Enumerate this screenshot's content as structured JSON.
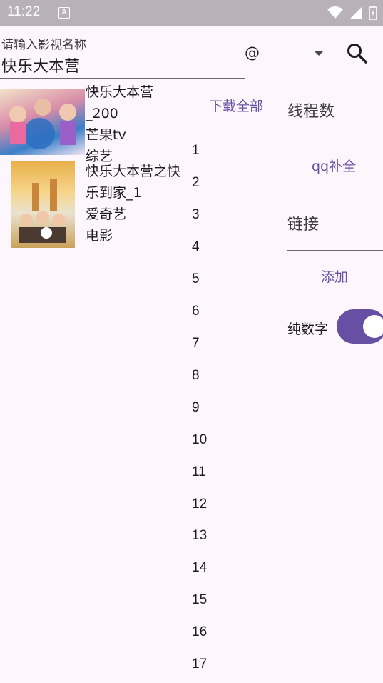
{
  "status_bar": {
    "time": "11:22",
    "notification_icon_letter": "A",
    "icons": [
      "wifi-icon",
      "cellular-signal-icon",
      "battery-icon"
    ]
  },
  "search": {
    "label": "请输入影视名称",
    "value": "快乐大本营",
    "source_selected": "@",
    "icon": "search-icon"
  },
  "results": [
    {
      "title_line1": "快乐大本营",
      "title_line2": "_200",
      "platform": "芒果tv",
      "category": "综艺"
    },
    {
      "title_line1": "快乐大本营之快",
      "title_line2": "乐到家_1",
      "platform": "爱奇艺",
      "category": "电影"
    }
  ],
  "download_all_label": "下载全部",
  "episodes": [
    "1",
    "2",
    "3",
    "4",
    "5",
    "6",
    "7",
    "8",
    "9",
    "10",
    "11",
    "12",
    "13",
    "14",
    "15",
    "16",
    "17"
  ],
  "settings": {
    "threads_placeholder": "线程数",
    "qq_complete_label": "qq补全",
    "link_placeholder": "链接",
    "add_label": "添加",
    "numeric_only_label": "纯数字",
    "numeric_only_enabled": true
  },
  "colors": {
    "accent": "#6750a4",
    "background": "#fdf6fd",
    "status_bar": "#b8b2b8"
  }
}
